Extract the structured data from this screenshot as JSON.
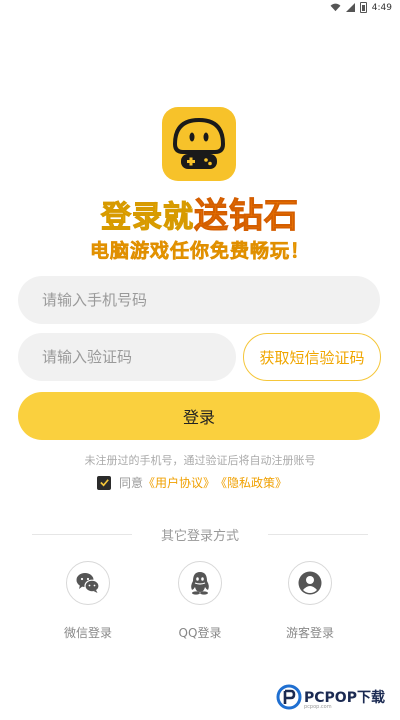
{
  "status_bar": {
    "time": "4:49",
    "icons": [
      "wifi-icon",
      "signal-icon",
      "battery-icon"
    ]
  },
  "logo": {
    "icon": "mushroom-gamepad-logo",
    "color": "#f7c22a"
  },
  "slogan": {
    "part1": "登录就",
    "part2": "送钻石",
    "subtitle": "电脑游戏任你免费畅玩！"
  },
  "form": {
    "phone_placeholder": "请输入手机号码",
    "code_placeholder": "请输入验证码",
    "get_code_label": "获取短信验证码",
    "login_label": "登录",
    "hint": "未注册过的手机号，通过验证后将自动注册账号",
    "agree_prefix": "同意",
    "user_agreement": "《用户协议》",
    "privacy_policy": "《隐私政策》",
    "agree_checked": true
  },
  "other_login": {
    "title": "其它登录方式",
    "methods": [
      {
        "label": "微信登录",
        "icon": "wechat-icon"
      },
      {
        "label": "QQ登录",
        "icon": "qq-icon"
      },
      {
        "label": "游客登录",
        "icon": "guest-user-icon"
      }
    ]
  },
  "watermark": {
    "text": "PCPOP下载",
    "sub": "pcpop.com"
  },
  "colors": {
    "accent": "#fad03e",
    "link": "#f0a000",
    "orange": "#f07a00"
  }
}
